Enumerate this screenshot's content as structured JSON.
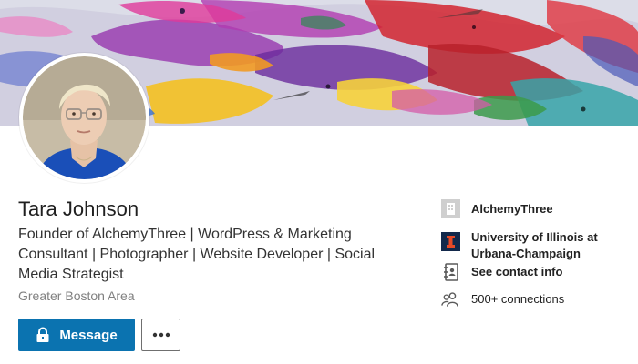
{
  "profile": {
    "name": "Tara Johnson",
    "headline": "Founder of AlchemyThree | WordPress & Marketing Consultant | Photographer | Website Developer | Social Media Strategist",
    "location": "Greater Boston Area"
  },
  "actions": {
    "message_label": "Message",
    "more_label": "More actions"
  },
  "sidebar": {
    "company": "AlchemyThree",
    "school_line1": "University of Illinois at",
    "school_line2": "Urbana-Champaign",
    "contact_info": "See contact info",
    "connections": "500+ connections"
  },
  "icons": {
    "company": "company-logo-icon",
    "school": "illinois-logo-icon",
    "contact": "address-book-icon",
    "connections": "people-icon",
    "message": "lock-icon",
    "more": "ellipsis-icon"
  },
  "colors": {
    "primary": "#0b73b0",
    "illinois_navy": "#13294b",
    "illinois_orange": "#e84a27"
  }
}
